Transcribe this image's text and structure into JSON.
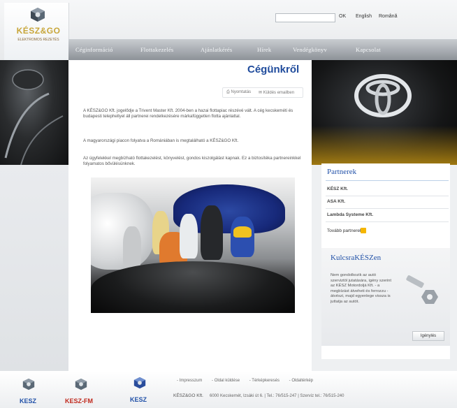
{
  "header": {
    "logo_text": "KÉSZ&GO",
    "logo_sub": "ELEKTROMOS REZETÉS",
    "search_button": "OK",
    "lang_english": "English",
    "lang_romana": "Română"
  },
  "nav": [
    "Céginformáció",
    "Flottakezelés",
    "Ajánlatkérés",
    "Hírek",
    "Vendégkönyv",
    "Kapcsolat"
  ],
  "main": {
    "title": "Cégünkről",
    "print_label": "Nyomtatás",
    "send_label": "Küldés emailben",
    "paragraphs": [
      "A KÉSZ&GO Kft. jogelődje a Trivent Master Kft. 2004-ben a hazai flottapiac részévé vált. A cég kecskeméti és budapesti telephellyel áll partnerei rendelkezésére márkafüggetlen flotta ajánlattal.",
      "A magyarországi piacon folyatva a Romániában is megtalálható a KÉSZ&GO Kft.",
      "Az ügyfelekkel megbízható flottakezelést, könyvelést, gondos kiszolgálást kapnak. Ez a biztosítéka partnereinkkel folyamatos bővülésünknek."
    ]
  },
  "sidebar": {
    "partners_title": "Partnerek",
    "partners": [
      "KÉSZ Kft.",
      "ASA Kft.",
      "Lambda Systeme Kft."
    ],
    "more_partners": "Tovább partnerek",
    "keys_title": "KulcsraKÉSZen",
    "keys_text": "Nem gondolkozik az autó szerviztöl jutatására, igény szerint az KÉSZ Motordoljá Kft. - a megbízást átveheti és ferrozzu - átvészi, majd egyenlege vissza is juttatja az autót.",
    "keys_button": "Igénylés"
  },
  "footer": {
    "logos": [
      "KESZ",
      "KESZ-FM",
      "KESZ"
    ],
    "links": [
      "Impresszum",
      "Oldal küldése",
      "Térképkeresés",
      "Oldaltérkép"
    ],
    "company": "KÉSZ&GO Kft.",
    "address": "6000 Kecskemét, Izsáki út 6.  |  Tel.: 76/515-247  |  Szerviz tel.: 76/515-240"
  },
  "colors": {
    "brand_blue": "#1f4b9c",
    "nav_gray": "#9aa0a6",
    "accent_yellow": "#f5b600",
    "logo_gold": "#c8a63a",
    "footer_red": "#c0281c"
  }
}
